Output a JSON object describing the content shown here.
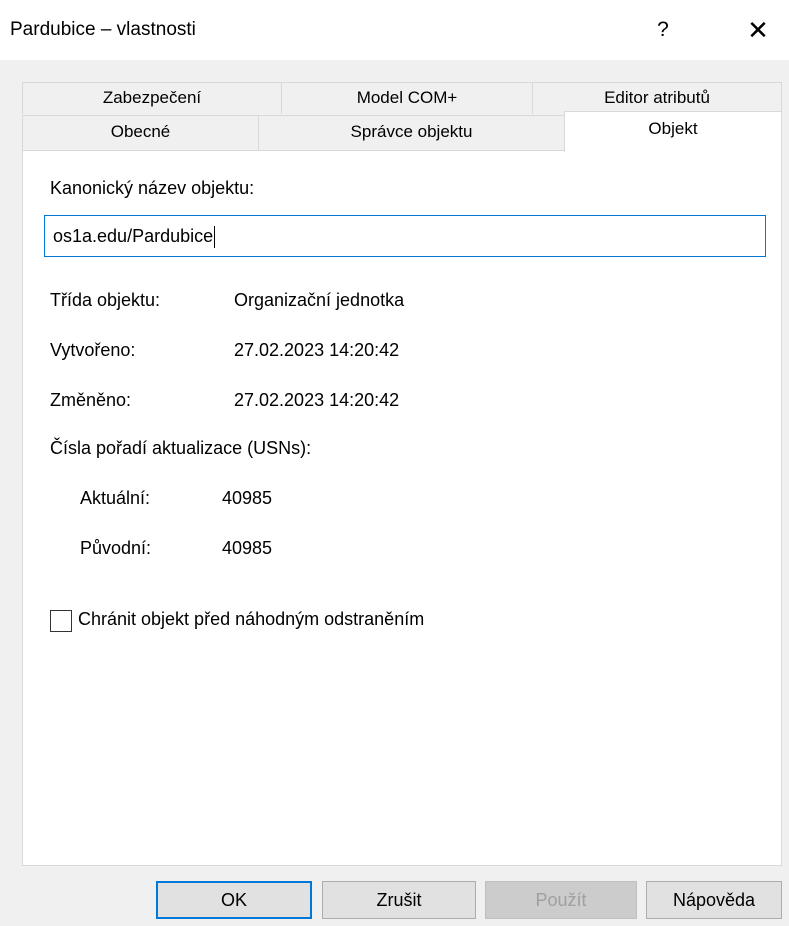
{
  "window": {
    "title": "Pardubice – vlastnosti",
    "help_glyph": "?",
    "close_glyph": "✕"
  },
  "tabs": {
    "row1": [
      "Zabezpečení",
      "Model COM+",
      "Editor atributů"
    ],
    "row2": [
      "Obecné",
      "Správce objektu",
      "Objekt"
    ],
    "active": "Objekt"
  },
  "form": {
    "canonical_label": "Kanonický název objektu:",
    "canonical_value": "os1a.edu/Pardubice",
    "class_label": "Třída objektu:",
    "class_value": "Organizační jednotka",
    "created_label": "Vytvořeno:",
    "created_value": "27.02.2023 14:20:42",
    "modified_label": "Změněno:",
    "modified_value": "27.02.2023 14:20:42",
    "usn_label": "Čísla pořadí aktualizace (USNs):",
    "usn_current_label": "Aktuální:",
    "usn_current_value": "40985",
    "usn_original_label": "Původní:",
    "usn_original_value": "40985",
    "protect_label": "Chránit objekt před náhodným odstraněním",
    "protect_checked": false
  },
  "buttons": {
    "ok": "OK",
    "cancel": "Zrušit",
    "apply": "Použít",
    "help": "Nápověda"
  },
  "colors": {
    "accent": "#0078d7",
    "background": "#f0f0f0",
    "panel": "#ffffff"
  }
}
